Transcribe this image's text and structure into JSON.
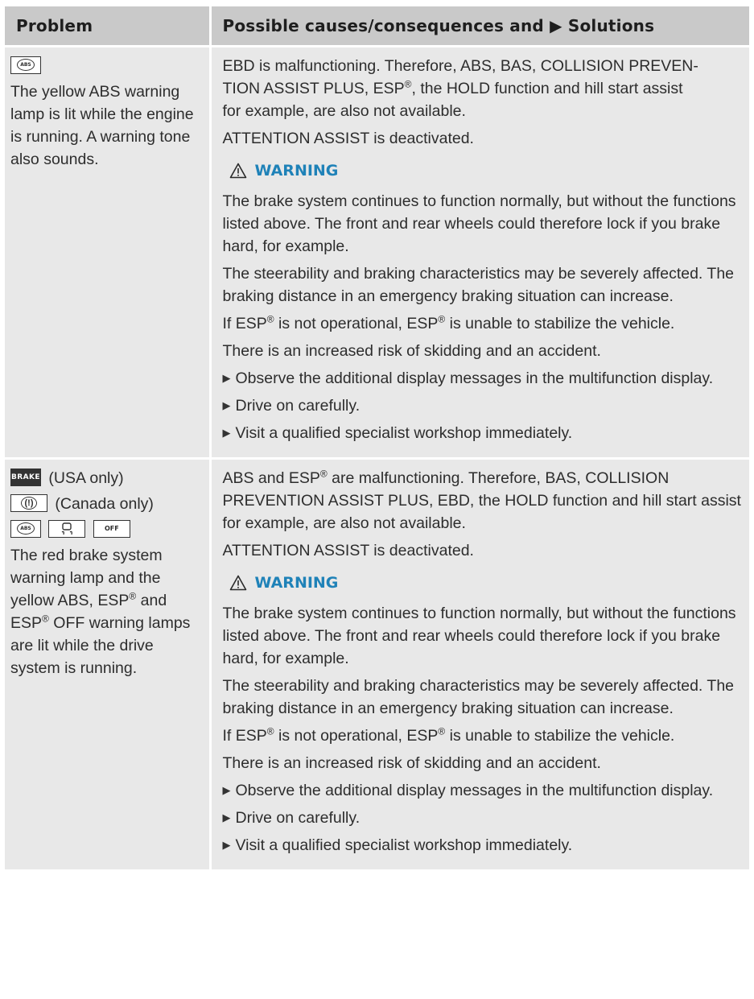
{
  "header": {
    "problem": "Problem",
    "solutions_prefix": "Possible causes/consequences and",
    "solutions_arrow": "▶",
    "solutions_suffix": "Solutions"
  },
  "rows": [
    {
      "lamps": {
        "abs_icon": "abs-warning-lamp-icon",
        "abs_text": "ABS"
      },
      "problem": "The yellow ABS warning lamp is lit while the engine is running. A warning tone also sounds.",
      "intro": {
        "l1": "EBD is malfunctioning. Therefore, ABS, BAS, COLLISION PREVEN-",
        "l2a": "TION ASSIST PLUS, ESP",
        "l2b": ", the HOLD function and hill start assist",
        "l3": "for example, are also not available."
      },
      "attention": "ATTENTION ASSIST is deactivated.",
      "warning_label": "WARNING",
      "warn_p1": "The brake system continues to function normally, but without the functions listed above. The front and rear wheels could therefore lock if you brake hard, for example.",
      "warn_p2": "The steerability and braking characteristics may be severely affected. The braking distance in an emergency braking situation can increase.",
      "esp": {
        "a": "If ESP",
        "b": " is not operational, ESP",
        "c": " is unable to stabilize the vehicle."
      },
      "risk": "There is an increased risk of skidding and an accident.",
      "bullets": [
        "Observe the additional display messages in the multifunction display.",
        "Drive on carefully.",
        "Visit a qualified specialist workshop immediately."
      ]
    },
    {
      "lamps": {
        "brake_text": "BRAKE",
        "usa_only": "(USA only)",
        "canada_icon_text": "(!)",
        "canada_only": "(Canada only)",
        "abs_text": "ABS",
        "esp_icon": "esp-warning-lamp-icon",
        "espoff_text": "OFF"
      },
      "problem": {
        "a": "The red brake system warning lamp and the yellow ABS, ESP",
        "b": " and ESP",
        "c": " OFF warning lamps are lit while the drive system is running."
      },
      "intro": {
        "a": "ABS and ESP",
        "b": " are malfunctioning. Therefore, BAS, COLLISION PREVENTION ASSIST PLUS, EBD, the HOLD function and hill start assist for example, are also not available."
      },
      "attention": "ATTENTION ASSIST is deactivated.",
      "warning_label": "WARNING",
      "warn_p1": "The brake system continues to function normally, but without the functions listed above. The front and rear wheels could therefore lock if you brake hard, for example.",
      "warn_p2": "The steerability and braking characteristics may be severely affected. The braking distance in an emergency braking situation can increase.",
      "esp": {
        "a": "If ESP",
        "b": " is not operational, ESP",
        "c": " is unable to stabilize the vehicle."
      },
      "risk": "There is an increased risk of skidding and an accident.",
      "bullets": [
        "Observe the additional display messages in the multifunction display.",
        "Drive on carefully.",
        "Visit a qualified specialist workshop immediately."
      ]
    }
  ],
  "reg_mark": "®",
  "bullet_symbol": "▶",
  "colors": {
    "header_bg": "#c9c9c9",
    "cell_bg": "#e8e8e8",
    "warning_blue": "#1f82b8"
  }
}
